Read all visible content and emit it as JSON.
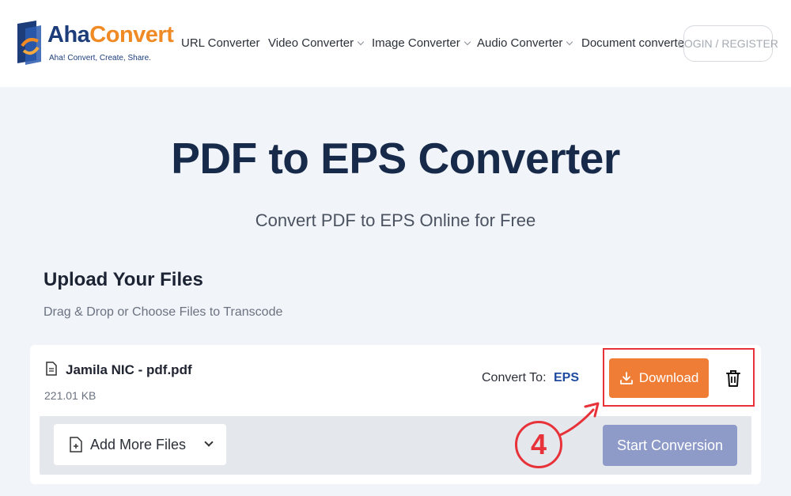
{
  "brand": {
    "name_part1": "Aha",
    "name_part2": "Convert",
    "tagline": "Aha! Convert, Create, Share."
  },
  "nav": {
    "items": [
      {
        "label": "URL Converter",
        "has_dropdown": false
      },
      {
        "label": "Video Converter",
        "has_dropdown": true
      },
      {
        "label": "Image Converter",
        "has_dropdown": true
      },
      {
        "label": "Audio Converter",
        "has_dropdown": true
      },
      {
        "label": "Document converter",
        "has_dropdown": false
      }
    ],
    "login_label": "LOGIN / REGISTER"
  },
  "hero": {
    "title": "PDF to EPS Converter",
    "subtitle": "Convert PDF to EPS Online for Free"
  },
  "upload": {
    "title": "Upload Your Files",
    "subtitle": "Drag & Drop or Choose Files to Transcode"
  },
  "file": {
    "name": "Jamila NIC - pdf.pdf",
    "size": "221.01 KB",
    "convert_to_label": "Convert To:",
    "convert_to_value": "EPS",
    "download_label": "Download"
  },
  "actions": {
    "add_more_label": "Add More Files",
    "start_label": "Start Conversion"
  },
  "annotation": {
    "step_number": "4"
  },
  "colors": {
    "brand_blue": "#1c3d7a",
    "brand_orange": "#f08a24",
    "download_orange": "#ef7d36",
    "highlight_red": "#e8323a",
    "start_disabled": "#8e9ac8"
  },
  "icons": [
    "logo-mark",
    "chevron-down-icon",
    "file-icon",
    "download-icon",
    "trash-icon",
    "add-file-icon",
    "step-arrow"
  ]
}
